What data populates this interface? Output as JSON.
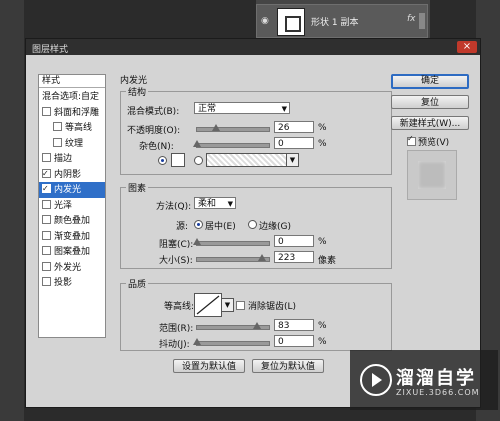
{
  "layers_panel": {
    "layer_name": "形状 1 副本",
    "fx_label": "fx"
  },
  "dialog": {
    "title": "图层样式",
    "close_symbol": "×",
    "style_list": {
      "header": "样式",
      "items": [
        {
          "label": "混合选项:自定",
          "has_checkbox": false,
          "checked": false,
          "indent": false,
          "selected": false
        },
        {
          "label": "斜面和浮雕",
          "has_checkbox": true,
          "checked": false,
          "indent": false,
          "selected": false
        },
        {
          "label": "等高线",
          "has_checkbox": true,
          "checked": false,
          "indent": true,
          "selected": false
        },
        {
          "label": "纹理",
          "has_checkbox": true,
          "checked": false,
          "indent": true,
          "selected": false
        },
        {
          "label": "描边",
          "has_checkbox": true,
          "checked": false,
          "indent": false,
          "selected": false
        },
        {
          "label": "内阴影",
          "has_checkbox": true,
          "checked": true,
          "indent": false,
          "selected": false
        },
        {
          "label": "内发光",
          "has_checkbox": true,
          "checked": true,
          "indent": false,
          "selected": true
        },
        {
          "label": "光泽",
          "has_checkbox": true,
          "checked": false,
          "indent": false,
          "selected": false
        },
        {
          "label": "颜色叠加",
          "has_checkbox": true,
          "checked": false,
          "indent": false,
          "selected": false
        },
        {
          "label": "渐变叠加",
          "has_checkbox": true,
          "checked": false,
          "indent": false,
          "selected": false
        },
        {
          "label": "图案叠加",
          "has_checkbox": true,
          "checked": false,
          "indent": false,
          "selected": false
        },
        {
          "label": "外发光",
          "has_checkbox": true,
          "checked": false,
          "indent": false,
          "selected": false
        },
        {
          "label": "投影",
          "has_checkbox": true,
          "checked": false,
          "indent": false,
          "selected": false
        }
      ]
    },
    "panel_title": "内发光",
    "structure": {
      "group_label": "结构",
      "blend_mode_label": "混合模式(B):",
      "blend_mode_value": "正常",
      "opacity_label": "不透明度(O):",
      "opacity_value": "26",
      "opacity_fraction": 0.26,
      "noise_label": "杂色(N):",
      "noise_value": "0",
      "noise_fraction": 0,
      "unit": "%"
    },
    "elements": {
      "group_label": "图素",
      "technique_label": "方法(Q):",
      "technique_value": "柔和",
      "source_label": "源:",
      "source_center": "居中(E)",
      "source_edge": "边缘(G)",
      "source_selected": "center",
      "choke_label": "阻塞(C):",
      "choke_value": "0",
      "choke_fraction": 0,
      "size_label": "大小(S):",
      "size_value": "223",
      "size_fraction": 0.9,
      "percent_unit": "%",
      "px_unit": "像素"
    },
    "quality": {
      "group_label": "品质",
      "contour_label": "等高线:",
      "antialias_label": "消除锯齿(L)",
      "antialias_checked": false,
      "range_label": "范围(R):",
      "range_value": "83",
      "range_fraction": 0.83,
      "jitter_label": "抖动(J):",
      "jitter_value": "0",
      "jitter_fraction": 0,
      "unit": "%"
    },
    "buttons": {
      "make_default": "设置为默认值",
      "reset_default": "复位为默认值",
      "ok": "确定",
      "reset": "复位",
      "new_style": "新建样式(W)...",
      "preview_label": "预览(V)",
      "preview_checked": true
    }
  },
  "watermark": {
    "title": "溜溜自学",
    "subtitle": "ZIXUE.3D66.COM"
  },
  "colors": {
    "selection": "#2f6fc8",
    "dialog_bg": "#d4d4d4",
    "titlebar": "#2f2f2f",
    "close": "#c0392b"
  }
}
